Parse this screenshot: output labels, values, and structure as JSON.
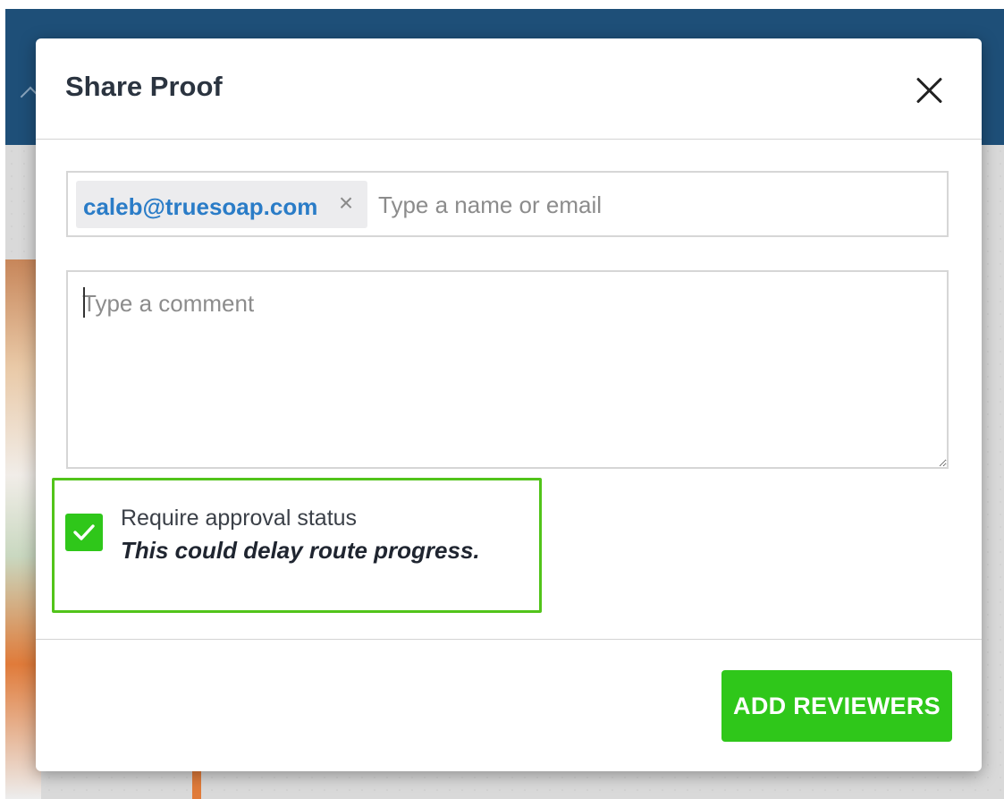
{
  "modal": {
    "title": "Share Proof",
    "close_icon": "close-icon",
    "recipients": {
      "tags": [
        "caleb@truesoap.com"
      ],
      "remove_glyph": "×",
      "placeholder": "Type a name or email"
    },
    "comment": {
      "placeholder": "Type a comment",
      "value": ""
    },
    "approval": {
      "checked": true,
      "label": "Require approval status",
      "note": "This could delay route progress."
    },
    "primary_button": {
      "label": "ADD REVIEWERS"
    }
  },
  "colors": {
    "accent_green": "#2fc71a",
    "highlight_green": "#52c41a",
    "tag_text_blue": "#2a7cc7",
    "header_blue": "#1e4f78"
  }
}
